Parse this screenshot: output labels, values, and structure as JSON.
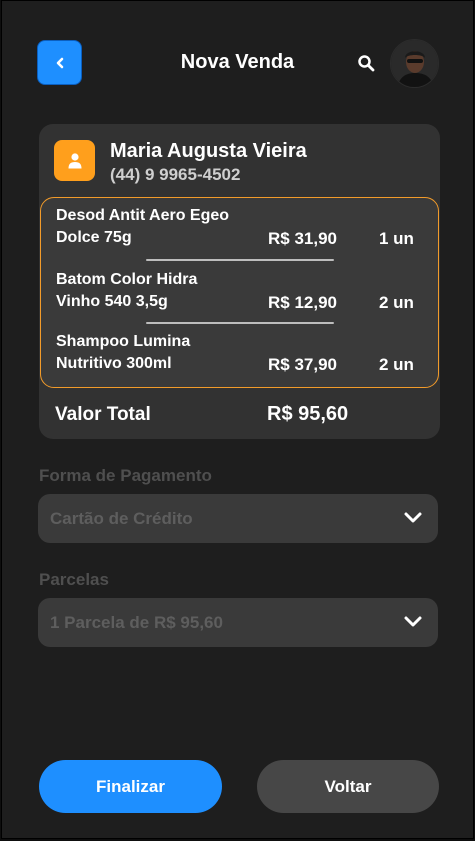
{
  "header": {
    "title": "Nova Venda"
  },
  "client": {
    "name": "Maria Augusta Vieira",
    "phone": "(44) 9 9965-4502"
  },
  "items": [
    {
      "name_line1": "Desod Antit Aero Egeo",
      "name_line2": "Dolce 75g",
      "price": "R$ 31,90",
      "qty": "1 un"
    },
    {
      "name_line1": "Batom Color Hidra",
      "name_line2": "Vinho 540 3,5g",
      "price": "R$ 12,90",
      "qty": "2 un"
    },
    {
      "name_line1": "Shampoo Lumina",
      "name_line2": "Nutritivo 300ml",
      "price": "R$ 37,90",
      "qty": "2 un"
    }
  ],
  "total": {
    "label": "Valor Total",
    "value": "R$ 95,60"
  },
  "payment": {
    "label": "Forma de Pagamento",
    "value": "Cartão de Crédito"
  },
  "installments": {
    "label": "Parcelas",
    "value": "1 Parcela de R$ 95,60"
  },
  "actions": {
    "finalize_label": "Finalizar",
    "back_label": "Voltar"
  },
  "colors": {
    "accent": "#1e8fff",
    "client_icon_bg": "#ff9f1c",
    "items_border": "#f29b2a"
  }
}
